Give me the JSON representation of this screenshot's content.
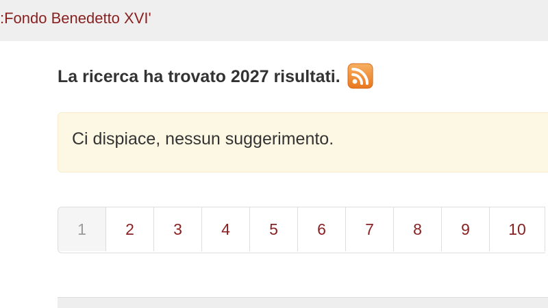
{
  "header": {
    "breadcrumb_text": ":Fondo Benedetto XVI'"
  },
  "results": {
    "heading": "La ricerca ha trovato 2027 risultati.",
    "rss_icon": "rss-feed-icon",
    "rss_color": "#f0882a"
  },
  "suggestion_alert": {
    "text": "Ci dispiace, nessun suggerimento."
  },
  "pagination": {
    "pages": [
      "1",
      "2",
      "3",
      "4",
      "5",
      "6",
      "7",
      "8",
      "9",
      "10"
    ],
    "current": "1"
  },
  "colors": {
    "link": "#8a1f1f",
    "alert_bg": "#fcf8e3",
    "topbar_bg": "#efefef"
  }
}
